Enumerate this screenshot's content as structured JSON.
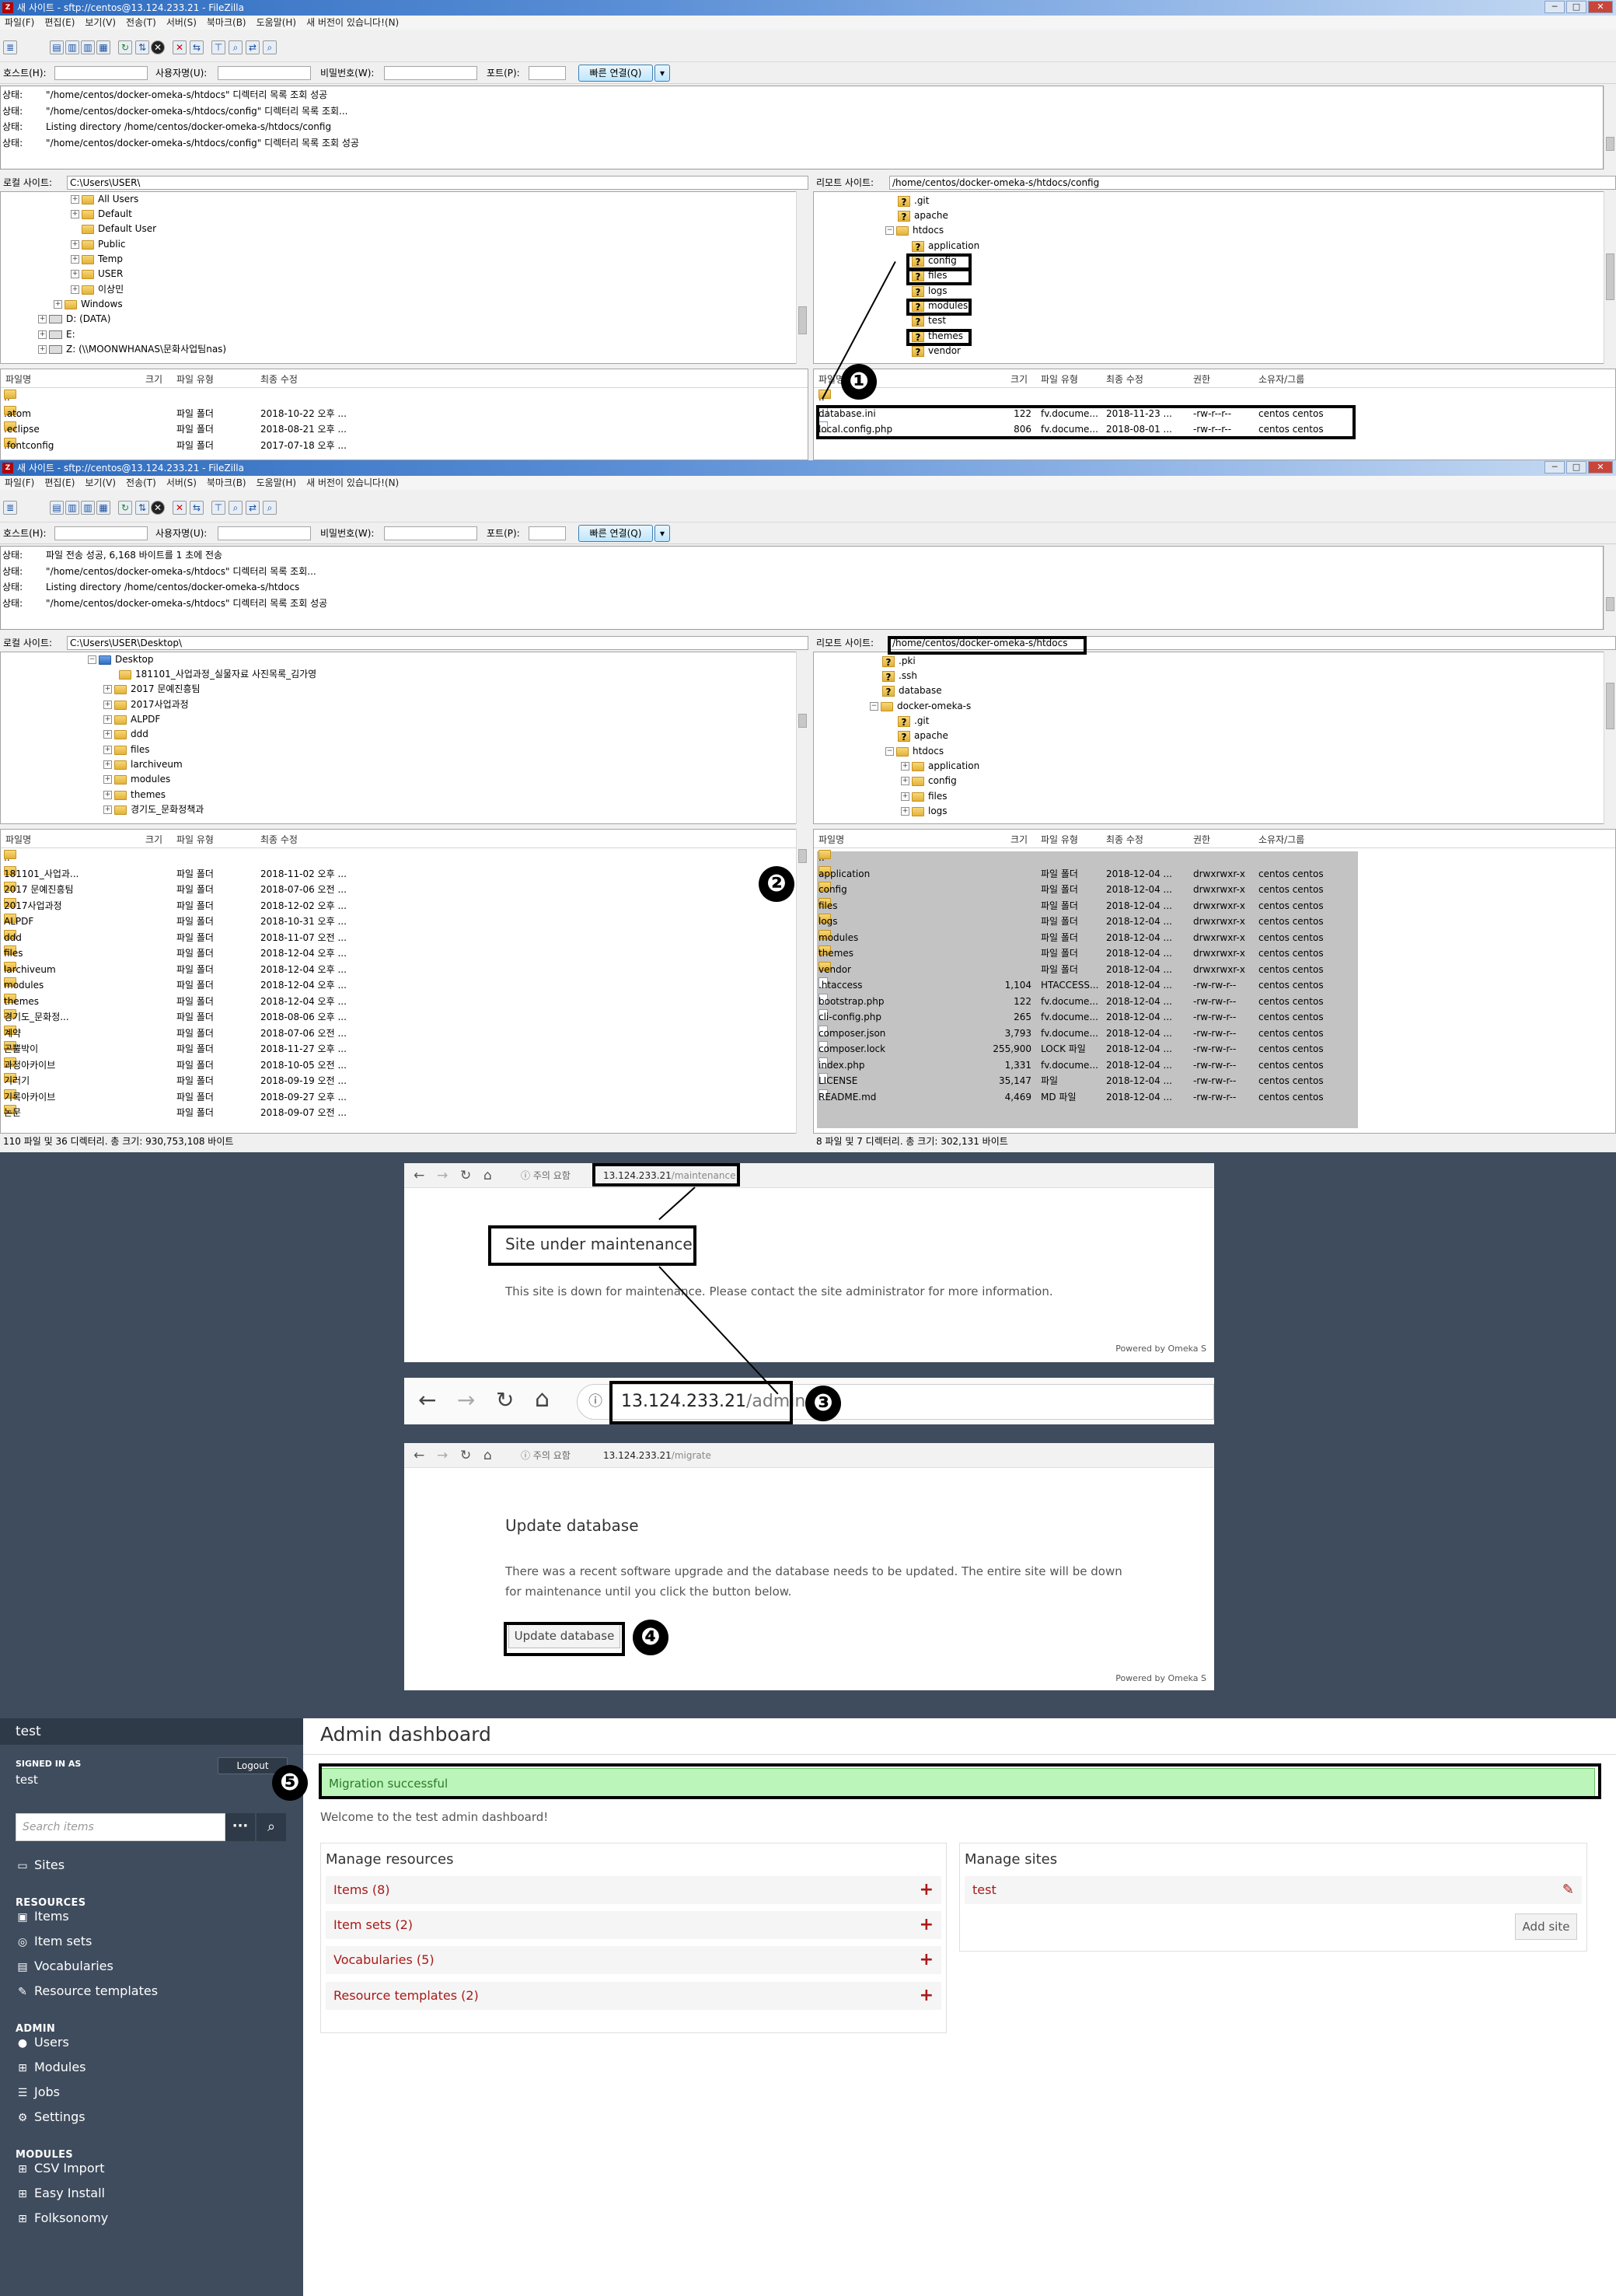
{
  "fz1": {
    "title": "새 사이트 - sftp://centos@13.124.233.21 - FileZilla",
    "menu": [
      "파일(F)",
      "편집(E)",
      "보기(V)",
      "전송(T)",
      "서버(S)",
      "북마크(B)",
      "도움말(H)",
      "새 버전이 있습니다!(N)"
    ],
    "quick": {
      "host": "호스트(H):",
      "user": "사용자명(U):",
      "pass": "비밀번호(W):",
      "port": "포트(P):",
      "connect": "빠른 연결(Q)"
    },
    "log": [
      {
        "k": "상태:",
        "v": "\"/home/centos/docker-omeka-s/htdocs\" 디렉터리 목록 조회 성공"
      },
      {
        "k": "상태:",
        "v": "\"/home/centos/docker-omeka-s/htdocs/config\" 디렉터리 목록 조회..."
      },
      {
        "k": "상태:",
        "v": "Listing directory /home/centos/docker-omeka-s/htdocs/config"
      },
      {
        "k": "상태:",
        "v": "\"/home/centos/docker-omeka-s/htdocs/config\" 디렉터리 목록 조회 성공"
      }
    ],
    "local_label": "로컬 사이트:",
    "local_path": "C:\\Users\\USER\\",
    "remote_label": "리모트 사이트:",
    "remote_path": "/home/centos/docker-omeka-s/htdocs/config",
    "local_tree": [
      "All Users",
      "Default",
      "Default User",
      "Public",
      "Temp",
      "USER",
      "이상민",
      "Windows",
      "D: (DATA)",
      "E:",
      "Z: (\\\\MOONWHANAS\\문화사업팀nas)"
    ],
    "remote_tree": [
      ".git",
      "apache",
      "htdocs",
      "application",
      "config",
      "files",
      "logs",
      "modules",
      "test",
      "themes",
      "vendor"
    ],
    "cols_local": [
      "파일명",
      "크기",
      "파일 유형",
      "최종 수정"
    ],
    "cols_remote": [
      "파일명",
      "크기",
      "파일 유형",
      "최종 수정",
      "권한",
      "소유자/그룹"
    ],
    "local_files": [
      {
        "n": "..",
        "s": "",
        "t": "",
        "d": ""
      },
      {
        "n": ".atom",
        "s": "",
        "t": "파일 폴더",
        "d": "2018-10-22 오후 ..."
      },
      {
        "n": ".eclipse",
        "s": "",
        "t": "파일 폴더",
        "d": "2018-08-21 오후 ..."
      },
      {
        "n": ".fontconfig",
        "s": "",
        "t": "파일 폴더",
        "d": "2017-07-18 오후 ..."
      }
    ],
    "remote_files": [
      {
        "n": "..",
        "s": "",
        "t": "",
        "d": "",
        "p": "",
        "o": ""
      },
      {
        "n": "database.ini",
        "s": "122",
        "t": "fv.docume...",
        "d": "2018-11-23 ...",
        "p": "-rw-r--r--",
        "o": "centos centos"
      },
      {
        "n": "local.config.php",
        "s": "806",
        "t": "fv.docume...",
        "d": "2018-08-01 ...",
        "p": "-rw-r--r--",
        "o": "centos centos"
      }
    ]
  },
  "fz2": {
    "title": "새 사이트 - sftp://centos@13.124.233.21 - FileZilla",
    "menu": [
      "파일(F)",
      "편집(E)",
      "보기(V)",
      "전송(T)",
      "서버(S)",
      "북마크(B)",
      "도움말(H)",
      "새 버전이 있습니다!(N)"
    ],
    "quick": {
      "host": "호스트(H):",
      "user": "사용자명(U):",
      "pass": "비밀번호(W):",
      "port": "포트(P):",
      "connect": "빠른 연결(Q)"
    },
    "log": [
      {
        "k": "상태:",
        "v": "파일 전송 성공, 6,168 바이트를 1 초에 전송"
      },
      {
        "k": "상태:",
        "v": "\"/home/centos/docker-omeka-s/htdocs\" 디렉터리 목록 조회..."
      },
      {
        "k": "상태:",
        "v": "Listing directory /home/centos/docker-omeka-s/htdocs"
      },
      {
        "k": "상태:",
        "v": "\"/home/centos/docker-omeka-s/htdocs\" 디렉터리 목록 조회 성공"
      }
    ],
    "local_label": "로컬 사이트:",
    "local_path": "C:\\Users\\USER\\Desktop\\",
    "remote_label": "리모트 사이트:",
    "remote_path": "/home/centos/docker-omeka-s/htdocs",
    "local_tree": [
      "Desktop",
      "181101_사업과정_실물자료 사진목록_김가영",
      "2017 문예진흥팀",
      "2017사업과정",
      "ALPDF",
      "ddd",
      "files",
      "larchiveum",
      "modules",
      "themes",
      "경기도_문화정책과"
    ],
    "remote_tree": [
      ".pki",
      ".ssh",
      "database",
      "docker-omeka-s",
      ".git",
      "apache",
      "htdocs",
      "application",
      "config",
      "files",
      "logs"
    ],
    "cols_local": [
      "파일명",
      "크기",
      "파일 유형",
      "최종 수정"
    ],
    "cols_remote": [
      "파일명",
      "크기",
      "파일 유형",
      "최종 수정",
      "권한",
      "소유자/그룹"
    ],
    "local_files": [
      {
        "n": "..",
        "s": "",
        "t": "",
        "d": ""
      },
      {
        "n": "181101_사업과...",
        "s": "",
        "t": "파일 폴더",
        "d": "2018-11-02 오후 ..."
      },
      {
        "n": "2017 문예진흥팀",
        "s": "",
        "t": "파일 폴더",
        "d": "2018-07-06 오전 ..."
      },
      {
        "n": "2017사업과정",
        "s": "",
        "t": "파일 폴더",
        "d": "2018-12-02 오후 ..."
      },
      {
        "n": "ALPDF",
        "s": "",
        "t": "파일 폴더",
        "d": "2018-10-31 오후 ..."
      },
      {
        "n": "ddd",
        "s": "",
        "t": "파일 폴더",
        "d": "2018-11-07 오전 ..."
      },
      {
        "n": "files",
        "s": "",
        "t": "파일 폴더",
        "d": "2018-12-04 오후 ..."
      },
      {
        "n": "larchiveum",
        "s": "",
        "t": "파일 폴더",
        "d": "2018-12-04 오후 ..."
      },
      {
        "n": "modules",
        "s": "",
        "t": "파일 폴더",
        "d": "2018-12-04 오후 ..."
      },
      {
        "n": "themes",
        "s": "",
        "t": "파일 폴더",
        "d": "2018-12-04 오후 ..."
      },
      {
        "n": "경기도_문화정...",
        "s": "",
        "t": "파일 폴더",
        "d": "2018-08-06 오후 ..."
      },
      {
        "n": "계약",
        "s": "",
        "t": "파일 폴더",
        "d": "2018-07-06 오전 ..."
      },
      {
        "n": "곤뿔박이",
        "s": "",
        "t": "파일 폴더",
        "d": "2018-11-27 오후 ..."
      },
      {
        "n": "과정아카이브",
        "s": "",
        "t": "파일 폴더",
        "d": "2018-10-05 오전 ..."
      },
      {
        "n": "기러기",
        "s": "",
        "t": "파일 폴더",
        "d": "2018-09-19 오전 ..."
      },
      {
        "n": "기록아카이브",
        "s": "",
        "t": "파일 폴더",
        "d": "2018-09-27 오후 ..."
      },
      {
        "n": "논문",
        "s": "",
        "t": "파일 폴더",
        "d": "2018-09-07 오전 ..."
      }
    ],
    "remote_files": [
      {
        "n": "..",
        "s": "",
        "t": "",
        "d": "",
        "p": "",
        "o": "",
        "f": 1
      },
      {
        "n": "application",
        "s": "",
        "t": "파일 폴더",
        "d": "2018-12-04 ...",
        "p": "drwxrwxr-x",
        "o": "centos centos",
        "f": 1
      },
      {
        "n": "config",
        "s": "",
        "t": "파일 폴더",
        "d": "2018-12-04 ...",
        "p": "drwxrwxr-x",
        "o": "centos centos",
        "f": 1
      },
      {
        "n": "files",
        "s": "",
        "t": "파일 폴더",
        "d": "2018-12-04 ...",
        "p": "drwxrwxr-x",
        "o": "centos centos",
        "f": 1
      },
      {
        "n": "logs",
        "s": "",
        "t": "파일 폴더",
        "d": "2018-12-04 ...",
        "p": "drwxrwxr-x",
        "o": "centos centos",
        "f": 1
      },
      {
        "n": "modules",
        "s": "",
        "t": "파일 폴더",
        "d": "2018-12-04 ...",
        "p": "drwxrwxr-x",
        "o": "centos centos",
        "f": 1
      },
      {
        "n": "themes",
        "s": "",
        "t": "파일 폴더",
        "d": "2018-12-04 ...",
        "p": "drwxrwxr-x",
        "o": "centos centos",
        "f": 1
      },
      {
        "n": "vendor",
        "s": "",
        "t": "파일 폴더",
        "d": "2018-12-04 ...",
        "p": "drwxrwxr-x",
        "o": "centos centos",
        "f": 1
      },
      {
        "n": ".htaccess",
        "s": "1,104",
        "t": "HTACCESS...",
        "d": "2018-12-04 ...",
        "p": "-rw-rw-r--",
        "o": "centos centos",
        "f": 0
      },
      {
        "n": "bootstrap.php",
        "s": "122",
        "t": "fv.docume...",
        "d": "2018-12-04 ...",
        "p": "-rw-rw-r--",
        "o": "centos centos",
        "f": 0
      },
      {
        "n": "cli-config.php",
        "s": "265",
        "t": "fv.docume...",
        "d": "2018-12-04 ...",
        "p": "-rw-rw-r--",
        "o": "centos centos",
        "f": 0
      },
      {
        "n": "composer.json",
        "s": "3,793",
        "t": "fv.docume...",
        "d": "2018-12-04 ...",
        "p": "-rw-rw-r--",
        "o": "centos centos",
        "f": 0
      },
      {
        "n": "composer.lock",
        "s": "255,900",
        "t": "LOCK 파일",
        "d": "2018-12-04 ...",
        "p": "-rw-rw-r--",
        "o": "centos centos",
        "f": 0
      },
      {
        "n": "index.php",
        "s": "1,331",
        "t": "fv.docume...",
        "d": "2018-12-04 ...",
        "p": "-rw-rw-r--",
        "o": "centos centos",
        "f": 0
      },
      {
        "n": "LICENSE",
        "s": "35,147",
        "t": "파일",
        "d": "2018-12-04 ...",
        "p": "-rw-rw-r--",
        "o": "centos centos",
        "f": 0
      },
      {
        "n": "README.md",
        "s": "4,469",
        "t": "MD 파일",
        "d": "2018-12-04 ...",
        "p": "-rw-rw-r--",
        "o": "centos centos",
        "f": 0
      }
    ],
    "status_local": "110 파일 및 36 디렉터리. 총 크기: 930,753,108 바이트",
    "status_remote": "8 파일 및 7 디렉터리. 총 크기: 302,131 바이트"
  },
  "b1": {
    "security": "ⓘ 주의 요함",
    "url_host": "13.124.233.21",
    "url_path": "/maintenance",
    "heading": "Site under maintenance",
    "body": "This site is down for maintenance. Please contact the site administrator for more information.",
    "footer": "Powered by Omeka S"
  },
  "b2": {
    "url_host": "13.124.233.21",
    "url_path": "/admin"
  },
  "b3": {
    "security": "ⓘ 주의 요함",
    "url_host": "13.124.233.21",
    "url_path": "/migrate",
    "heading": "Update database",
    "body1": "There was a recent software upgrade and the database needs to be updated. The entire site will be down",
    "body2": "for maintenance until you click the button below.",
    "button": "Update database",
    "footer": "Powered by Omeka S"
  },
  "badges": [
    "❶",
    "❷",
    "❸",
    "❹",
    "❺"
  ],
  "admin": {
    "site": "test",
    "signed_in_as": "SIGNED IN AS",
    "user": "test",
    "logout": "Logout",
    "search_placeholder": "Search items",
    "sites": "Sites",
    "resources": "RESOURCES",
    "items": "Items",
    "item_sets": "Item sets",
    "vocabularies": "Vocabularies",
    "resource_templates": "Resource templates",
    "admin_h": "ADMIN",
    "users": "Users",
    "modules": "Modules",
    "jobs": "Jobs",
    "settings": "Settings",
    "modules_h": "MODULES",
    "csv": "CSV Import",
    "easy": "Easy Install",
    "folk": "Folksonomy",
    "title": "Admin dashboard",
    "success": "Migration successful",
    "welcome": "Welcome to the test admin dashboard!",
    "manage_resources": "Manage resources",
    "res_rows": [
      "Items (8)",
      "Item sets (2)",
      "Vocabularies (5)",
      "Resource templates (2)"
    ],
    "manage_sites": "Manage sites",
    "site_row": "test",
    "add_site": "Add site"
  },
  "colors": {
    "omeka_red": "#a91919",
    "sidebar": "#3f4c5d",
    "success_bg": "#bcf5b9"
  }
}
